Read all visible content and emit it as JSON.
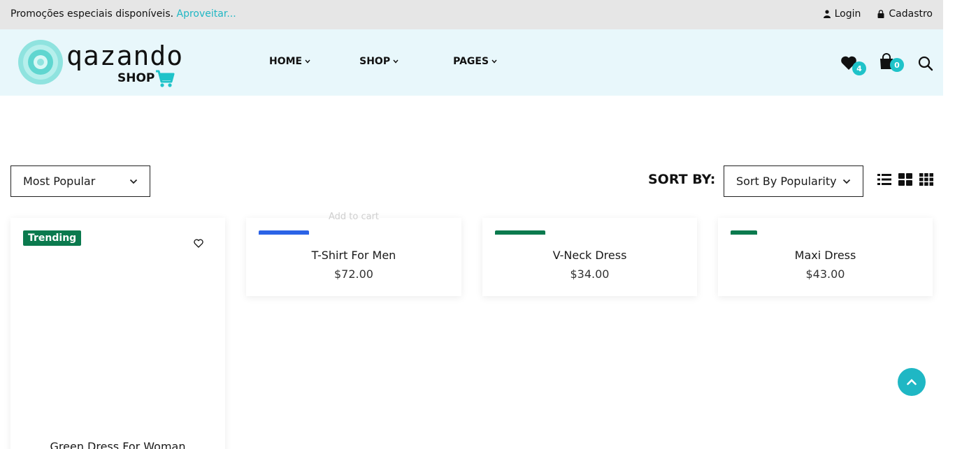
{
  "topbar": {
    "promo_text": "Promoções especiais disponíveis.",
    "promo_link": "Aproveitar...",
    "login_label": "Login",
    "register_label": "Cadastro"
  },
  "header": {
    "logo_brand": "qazando",
    "logo_sub": "SHOP",
    "nav": [
      {
        "label": "HOME"
      },
      {
        "label": "SHOP"
      },
      {
        "label": "PAGES"
      }
    ],
    "wishlist_count": "4",
    "cart_count": "0"
  },
  "filters": {
    "category_selected": "Most Popular",
    "sort_label": "SORT BY:",
    "sort_selected": "Sort By Popularity"
  },
  "products": [
    {
      "name": "Green Dress For Woman",
      "badge": "Trending"
    },
    {
      "name": "T-Shirt For Men",
      "price": "$72.00",
      "ghost_label": "Add to cart"
    },
    {
      "name": "V-Neck Dress",
      "price": "$34.00"
    },
    {
      "name": "Maxi Dress",
      "price": "$43.00"
    }
  ],
  "colors": {
    "accent": "#1fb7c4",
    "badge_green": "#0b7a4e",
    "blue_bar": "#2b63e6",
    "header_bg": "#e8f7fb",
    "topbar_bg": "#e6e6e6"
  }
}
